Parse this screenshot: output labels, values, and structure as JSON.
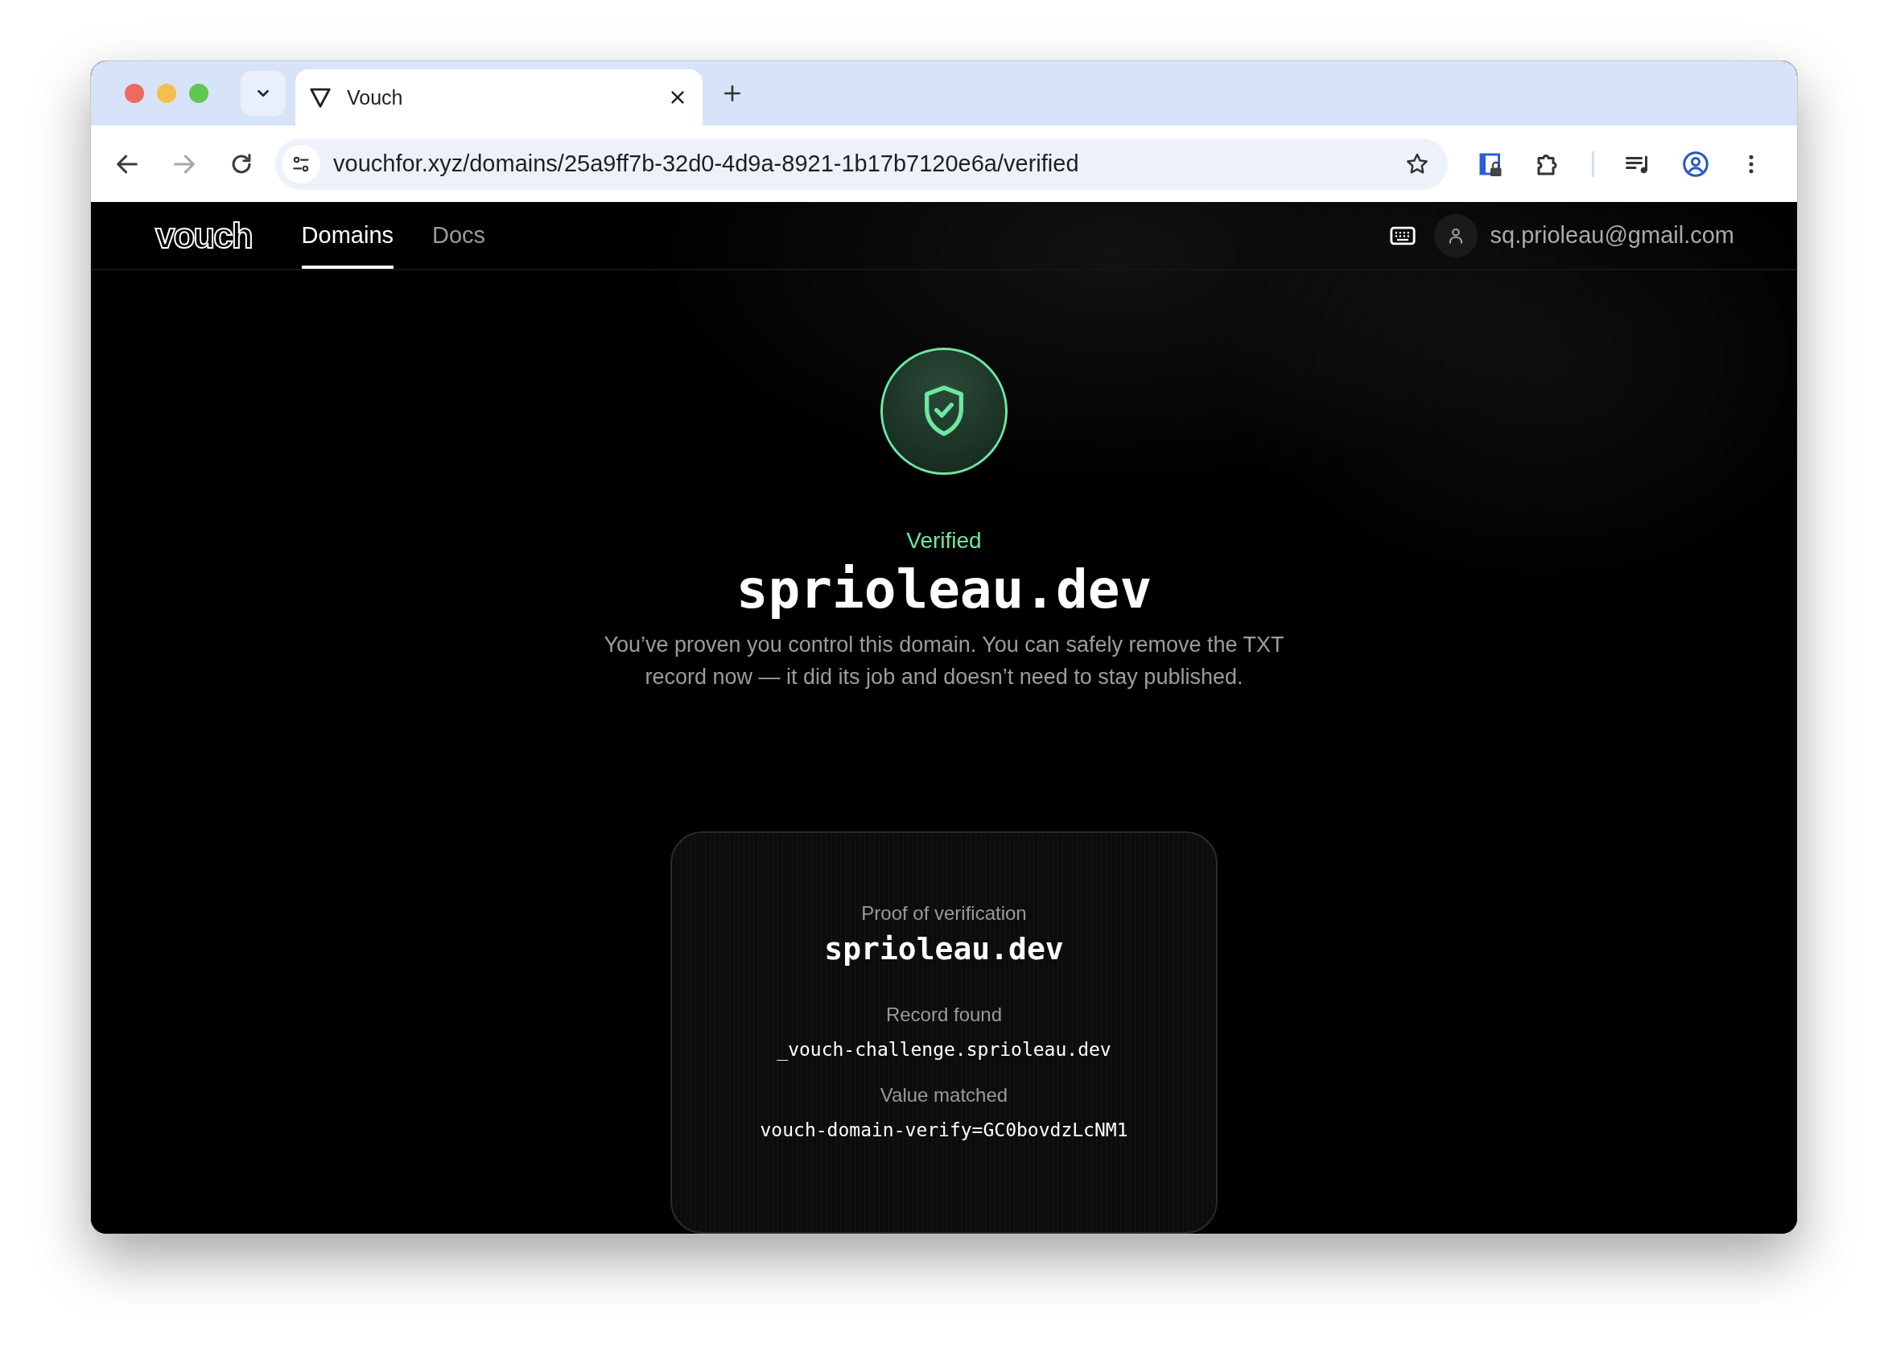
{
  "browser": {
    "tab": {
      "title": "Vouch"
    },
    "nav_buttons": [
      {
        "kind": "back",
        "disabled": false
      },
      {
        "kind": "forward",
        "disabled": true
      },
      {
        "kind": "reload",
        "disabled": false
      }
    ],
    "url": "vouchfor.xyz/domains/25a9ff7b-32d0-4d9a-8921-1b17b7120e6a/verified"
  },
  "nav": {
    "logo": "vouch",
    "links": [
      {
        "label": "Domains",
        "selected": true
      },
      {
        "label": "Docs",
        "selected": false
      }
    ],
    "user_email": "sq.prioleau@gmail.com"
  },
  "status": {
    "label": "Verified",
    "domain": "sprioleau.dev",
    "message": "You’ve proven you control this domain. You can safely remove the TXT record now — it did its job and doesn’t need to stay published."
  },
  "proof_card": {
    "title": "Proof of verification",
    "domain": "sprioleau.dev",
    "fields": [
      {
        "label": "Record found",
        "value": "_vouch-challenge.sprioleau.dev"
      },
      {
        "label": "Value matched",
        "value": "vouch-domain-verify=GC0bovdzLcNM1"
      }
    ]
  }
}
